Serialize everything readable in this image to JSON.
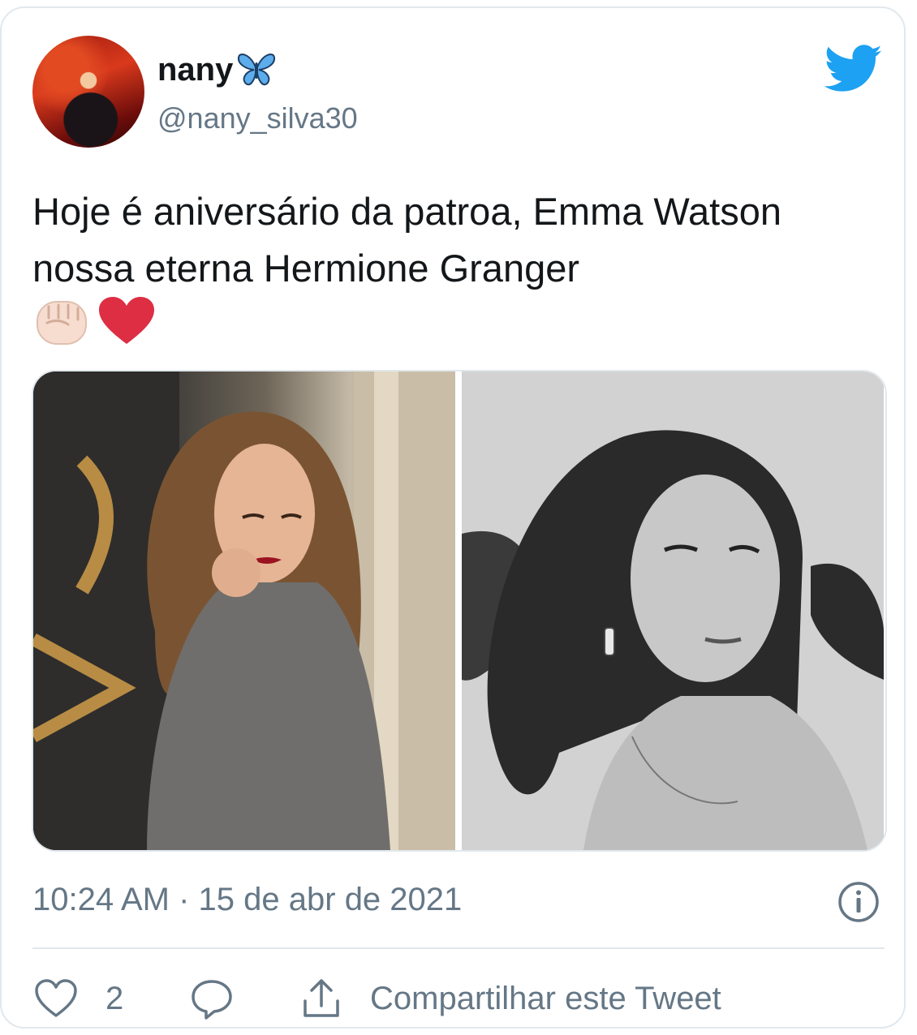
{
  "user": {
    "display_name": "nany",
    "handle": "@nany_silva30",
    "verified_emoji": "butterfly-emoji"
  },
  "tweet": {
    "text": "Hoje é aniversário da patroa, Emma Watson nossa eterna Hermione Granger",
    "emojis": [
      "raised-fist-emoji",
      "red-heart-emoji"
    ],
    "timestamp": "10:24 AM · 15 de abr de 2021"
  },
  "media": {
    "photos": [
      "color-photo",
      "black-and-white-photo"
    ]
  },
  "actions": {
    "like_count": "2",
    "share_label": "Compartilhar este Tweet"
  },
  "colors": {
    "twitter_blue": "#1da1f2",
    "secondary_text": "#657786",
    "heart_red": "#dd2e44",
    "border": "#e1e8ed"
  }
}
